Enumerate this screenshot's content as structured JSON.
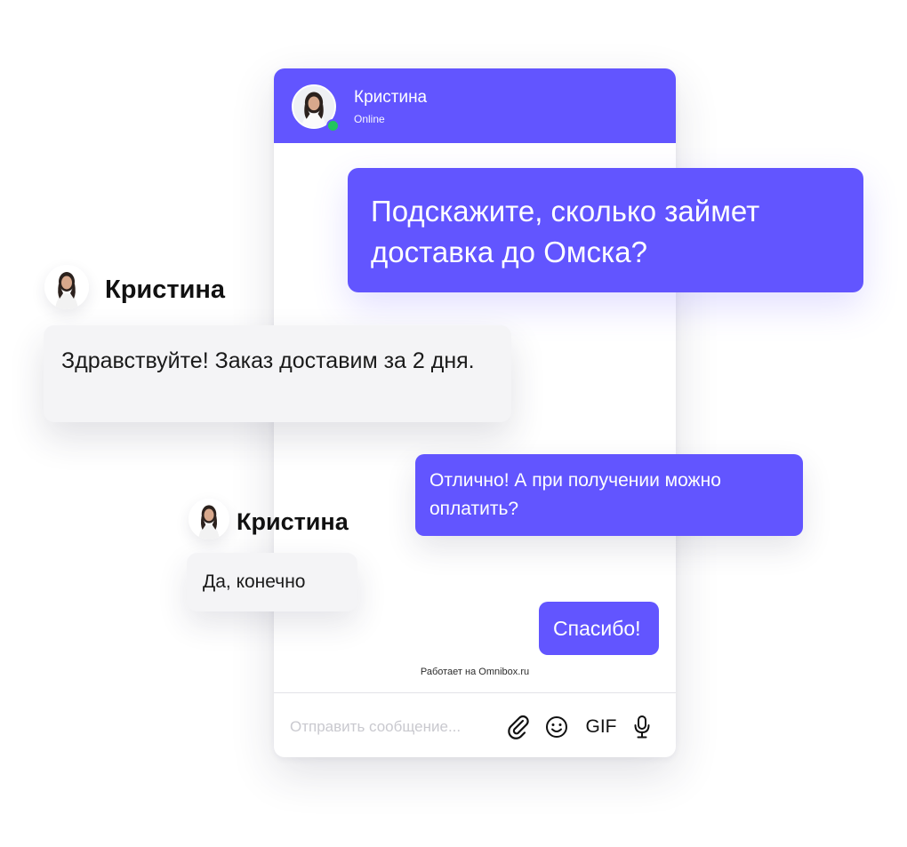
{
  "chat_header": {
    "name": "Кристина",
    "status": "Online"
  },
  "messages": [
    {
      "from": "user",
      "text": "Подскажите, сколько займет доставка до Омска?"
    },
    {
      "from": "agent",
      "sender": "Кристина",
      "text": "Здравствуйте! Заказ доставим за 2 дня."
    },
    {
      "from": "user",
      "text": "Отлично!  А при получении можно оплатить?"
    },
    {
      "from": "agent",
      "sender": "Кристина",
      "text": "Да, конечно"
    },
    {
      "from": "user",
      "text": "Спасибо!"
    }
  ],
  "footer": {
    "powered_by": "Работает на Omnibox.ru"
  },
  "composer": {
    "placeholder": "Отправить сообщение...",
    "gif_label": "GIF",
    "icons": [
      "paperclip-icon",
      "emoji-icon",
      "gif-button",
      "microphone-icon"
    ]
  },
  "colors": {
    "accent": "#6255ff",
    "online": "#22c55e",
    "incoming_bubble": "#f4f4f6"
  }
}
